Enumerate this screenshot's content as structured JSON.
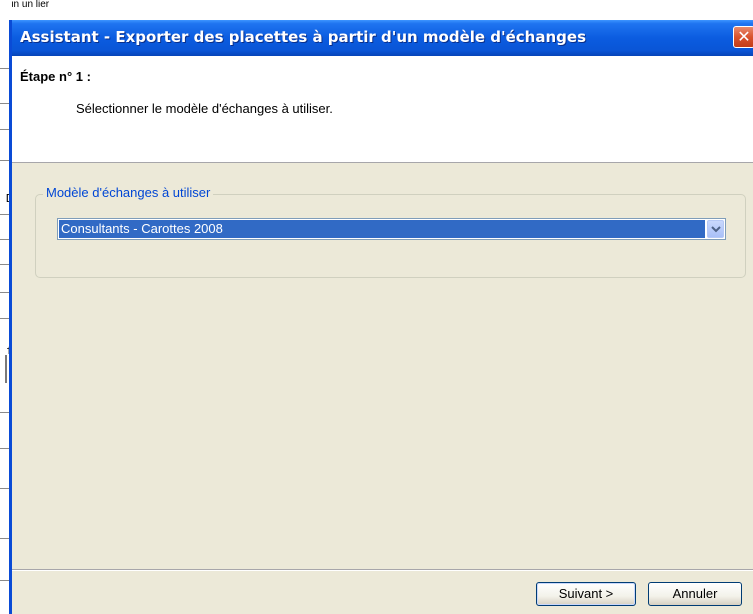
{
  "background": {
    "top_text": "un un lier",
    "side_glyphs": [
      "D",
      "f"
    ]
  },
  "window": {
    "title": "Assistant - Exporter des placettes à partir d'un modèle d'échanges",
    "close_glyph": "✕"
  },
  "step": {
    "title": "Étape n° 1 :",
    "description": "Sélectionner le modèle d'échanges à utiliser."
  },
  "group": {
    "legend": "Modèle d'échanges à utiliser",
    "combo_value": "Consultants - Carottes 2008"
  },
  "buttons": {
    "next": "Suivant >",
    "cancel": "Annuler"
  },
  "colors": {
    "title_bar": "#0a55d6",
    "selection": "#316ac5",
    "group_legend": "#0046d5"
  },
  "icons": {
    "dropdown": "chevron-down-icon",
    "close": "close-icon"
  }
}
